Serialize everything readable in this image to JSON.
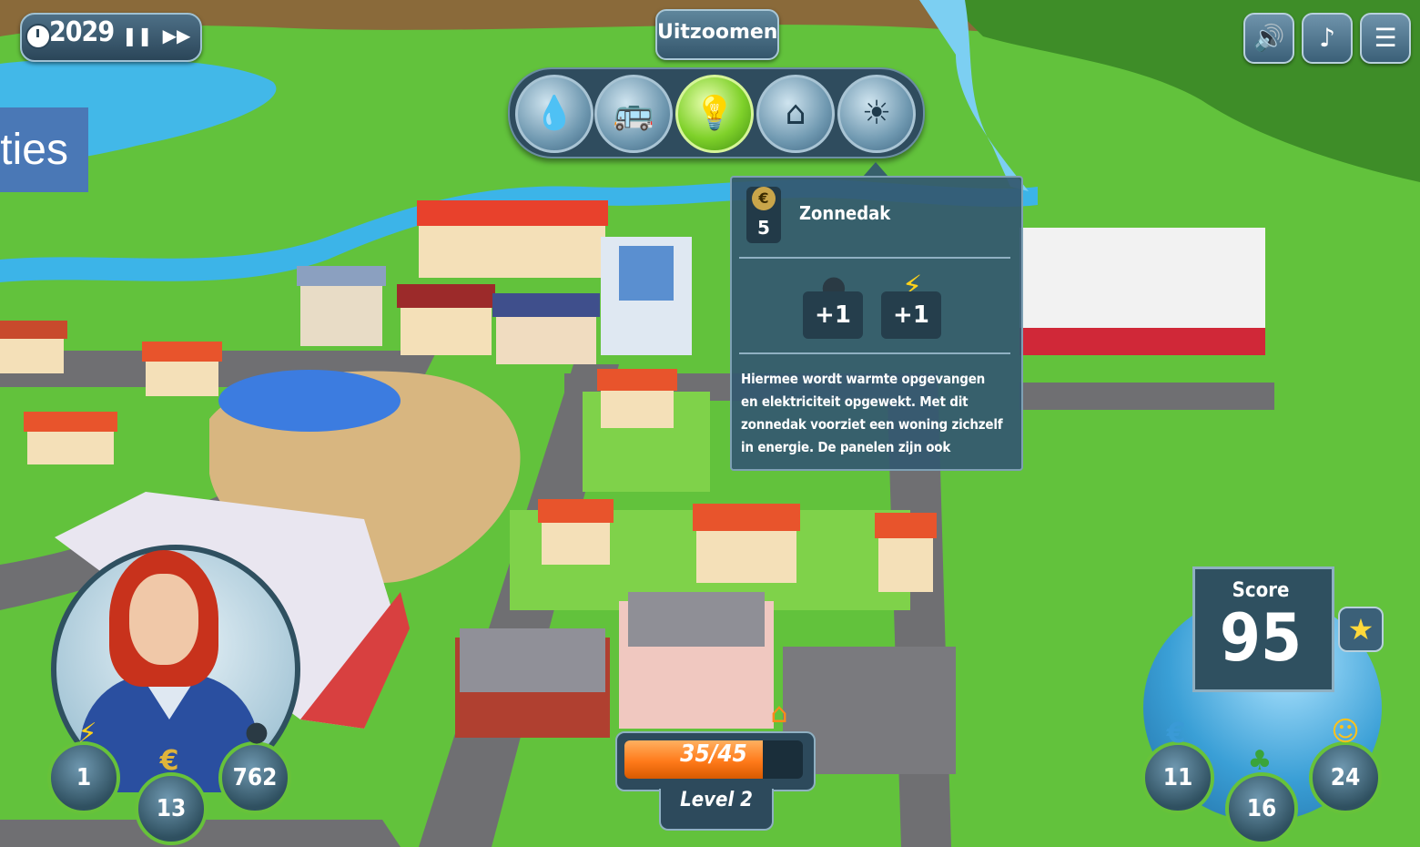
{
  "hud": {
    "year": "2029",
    "pause_icon": "pause-icon",
    "fastforward_icon": "fast-forward-icon",
    "zoom_label": "Uitzoomen",
    "side_label": "ties"
  },
  "categories": [
    {
      "name": "water",
      "icon": "water-tank-icon",
      "glyph": "💧"
    },
    {
      "name": "transport",
      "icon": "bus-icon",
      "glyph": "🚌"
    },
    {
      "name": "energy",
      "icon": "lightbulb-icon",
      "glyph": "💡"
    },
    {
      "name": "housing",
      "icon": "house-icon",
      "glyph": "⌂"
    },
    {
      "name": "solar",
      "icon": "solar-roof-icon",
      "glyph": "☀"
    }
  ],
  "top_right": {
    "sound_icon": "speaker-icon",
    "music_icon": "music-note-icon",
    "menu_icon": "menu-list-icon"
  },
  "tooltip": {
    "cost": "5",
    "title": "Zonnedak",
    "effects": [
      {
        "icon": "oil-drop-icon",
        "glyph": "💧",
        "value": "+1"
      },
      {
        "icon": "lightning-icon",
        "glyph": "⚡",
        "value": "+1"
      }
    ],
    "description_lines": [
      "Hiermee wordt warmte opgevangen",
      "en  elektriciteit opgewekt. Met dit",
      "zonnedak voorziet een woning zichzelf",
      "in energie. De panelen zijn ook"
    ]
  },
  "progress": {
    "text": "35/45",
    "value": 35,
    "max": 45,
    "level": "Level 2"
  },
  "player_stats": [
    {
      "icon": "lightning-icon",
      "glyph": "⚡",
      "value": "1"
    },
    {
      "icon": "money-bag-icon",
      "glyph": "€",
      "value": "13"
    },
    {
      "icon": "oil-drop-icon",
      "glyph": "💧",
      "value": "762"
    }
  ],
  "score": {
    "label": "Score",
    "value": "95"
  },
  "world_stats": [
    {
      "icon": "euro-icon",
      "glyph": "€",
      "value": "11"
    },
    {
      "icon": "tree-icon",
      "glyph": "🌳",
      "value": "16"
    },
    {
      "icon": "smiley-icon",
      "glyph": "☺",
      "value": "24"
    }
  ],
  "colors": {
    "panel": "#2f5060",
    "accent_green": "#67c23a",
    "progress_orange": "#ff7a1a"
  }
}
